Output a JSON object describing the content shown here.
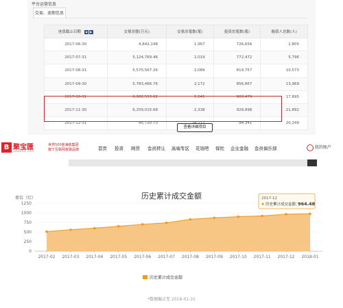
{
  "top_panel": {
    "section_title": "平台运营信息",
    "tab_label": "交易、逾期信息",
    "columns": [
      "信息截止日期",
      "交易总额(万元)",
      "交易总笔数(笔)",
      "投资总笔数(笔)",
      "融资人总数(人)"
    ],
    "rows": [
      [
        "2017-06-30",
        "4,842,148",
        "1,967",
        "726,656",
        "2,805"
      ],
      [
        "2017-07-31",
        "5,124,769.46",
        "2,019",
        "772,472",
        "5,796"
      ],
      [
        "2017-08-31",
        "5,570,567.26",
        "2,089",
        "819,757",
        "10,573"
      ],
      [
        "2017-09-30",
        "5,783,466.76",
        "2,172",
        "856,867",
        "13,969"
      ],
      [
        "2017-10-31",
        "6,082,533.62",
        "2,241",
        "900,479",
        "17,895"
      ],
      [
        "2017-11-30",
        "6,259,015.68",
        "2,338",
        "928,898",
        "21,892"
      ],
      [
        "2017-12-31",
        "45,720.73",
        "24,712",
        "94,341",
        "20,249"
      ]
    ],
    "detail_button": "查看详细项目"
  },
  "navbar": {
    "logo_text": "聚宝匯",
    "logo_mark": "B",
    "logo_sub": "jubaohui.com",
    "slogan_line1": "世界500强海航集团",
    "slogan_line2": "旗下互联网金融品牌",
    "items": [
      "首页",
      "投资",
      "网贷",
      "会员转让",
      "高端专区",
      "花钱吧",
      "保险",
      "企业金融",
      "会员俱乐部"
    ],
    "user_label": "我的账户"
  },
  "chart_data": {
    "type": "area",
    "title": "历史累计成交金额",
    "unit_label": "单位（亿）",
    "x": [
      "2017-02",
      "2017-03",
      "2017-04",
      "2017-05",
      "2017-06",
      "2017-07",
      "2017-08",
      "2017-09",
      "2017-10",
      "2017-11",
      "2017-12",
      "2018-01"
    ],
    "ylim": [
      0,
      1250
    ],
    "yticks": [
      0,
      250,
      500,
      750,
      1000,
      1250
    ],
    "series": [
      {
        "name": "历史累计成交金额",
        "values": [
          510,
          560,
          600,
          650,
          700,
          740,
          830,
          870,
          900,
          920,
          964.48,
          975
        ]
      }
    ],
    "tooltip": {
      "date": "2017-12",
      "label": "历史累计成交金额：",
      "value": "964.48"
    },
    "legend_label": "历史累计成交金额",
    "colors": {
      "fill": "#f6c078",
      "line": "#f0a030",
      "point": "#f29a20",
      "tooltip_border": "#f0a030"
    }
  },
  "footnote": "*数据截止至 2018-01-31"
}
